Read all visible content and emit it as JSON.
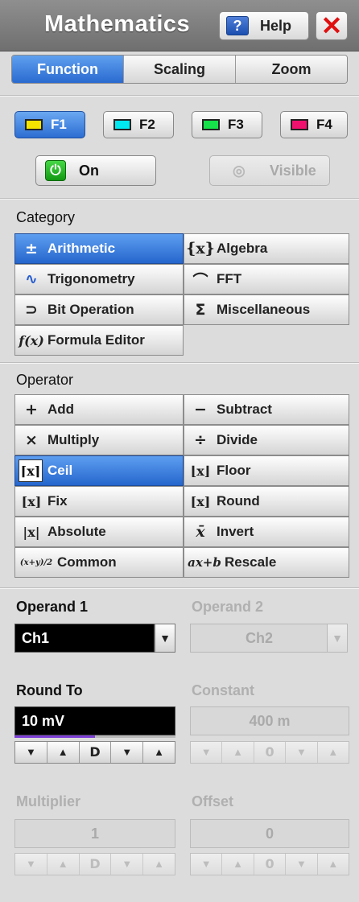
{
  "header": {
    "title": "Mathematics",
    "help_icon": "?",
    "help_label": "Help",
    "close_icon": "✕"
  },
  "tabs": [
    {
      "label": "Function",
      "active": true
    },
    {
      "label": "Scaling",
      "active": false
    },
    {
      "label": "Zoom",
      "active": false
    }
  ],
  "functions": [
    {
      "label": "F1",
      "color": "#f5e400",
      "active": true
    },
    {
      "label": "F2",
      "color": "#00e8f0",
      "active": false
    },
    {
      "label": "F3",
      "color": "#16e04a",
      "active": false
    },
    {
      "label": "F4",
      "color": "#f0106e",
      "active": false
    }
  ],
  "on_button": {
    "icon": "power-icon",
    "label": "On"
  },
  "visible_button": {
    "icon": "eye-icon",
    "label": "Visible"
  },
  "category": {
    "label": "Category",
    "items": [
      {
        "label": "Arithmetic",
        "icon": "±",
        "active": true
      },
      {
        "label": "Algebra",
        "icon": "{x}",
        "active": false
      },
      {
        "label": "Trigonometry",
        "icon": "∿",
        "active": false
      },
      {
        "label": "FFT",
        "icon": "⌒",
        "active": false
      },
      {
        "label": "Bit Operation",
        "icon": "⊃",
        "active": false
      },
      {
        "label": "Miscellaneous",
        "icon": "Σ",
        "active": false
      },
      {
        "label": "Formula Editor",
        "icon": "f(x)",
        "active": false
      }
    ]
  },
  "operator": {
    "label": "Operator",
    "items": [
      {
        "label": "Add",
        "icon": "+",
        "active": false
      },
      {
        "label": "Subtract",
        "icon": "−",
        "active": false
      },
      {
        "label": "Multiply",
        "icon": "×",
        "active": false
      },
      {
        "label": "Divide",
        "icon": "÷",
        "active": false
      },
      {
        "label": "Ceil",
        "icon": "⌈x⌉",
        "active": true
      },
      {
        "label": "Floor",
        "icon": "⌊x⌋",
        "active": false
      },
      {
        "label": "Fix",
        "icon": "[x]",
        "active": false
      },
      {
        "label": "Round",
        "icon": "[x]",
        "active": false
      },
      {
        "label": "Absolute",
        "icon": "|x|",
        "active": false
      },
      {
        "label": "Invert",
        "icon": "x̄",
        "active": false
      },
      {
        "label": "Common",
        "icon": "(x+y)/2",
        "active": false
      },
      {
        "label": "Rescale",
        "icon": "ax+b",
        "active": false
      }
    ]
  },
  "operand1": {
    "label": "Operand 1",
    "value": "Ch1",
    "arrow": "▼"
  },
  "operand2": {
    "label": "Operand 2",
    "value": "Ch2",
    "arrow": "▼"
  },
  "round_to": {
    "label": "Round To",
    "value": "10 mV",
    "level": 0.5
  },
  "constant": {
    "label": "Constant",
    "value": "400 m"
  },
  "multiplier": {
    "label": "Multiplier",
    "value": "1"
  },
  "offset": {
    "label": "Offset",
    "value": "0"
  },
  "stepper": {
    "down": "▼",
    "up": "▲",
    "default": "D",
    "zero": "0"
  }
}
